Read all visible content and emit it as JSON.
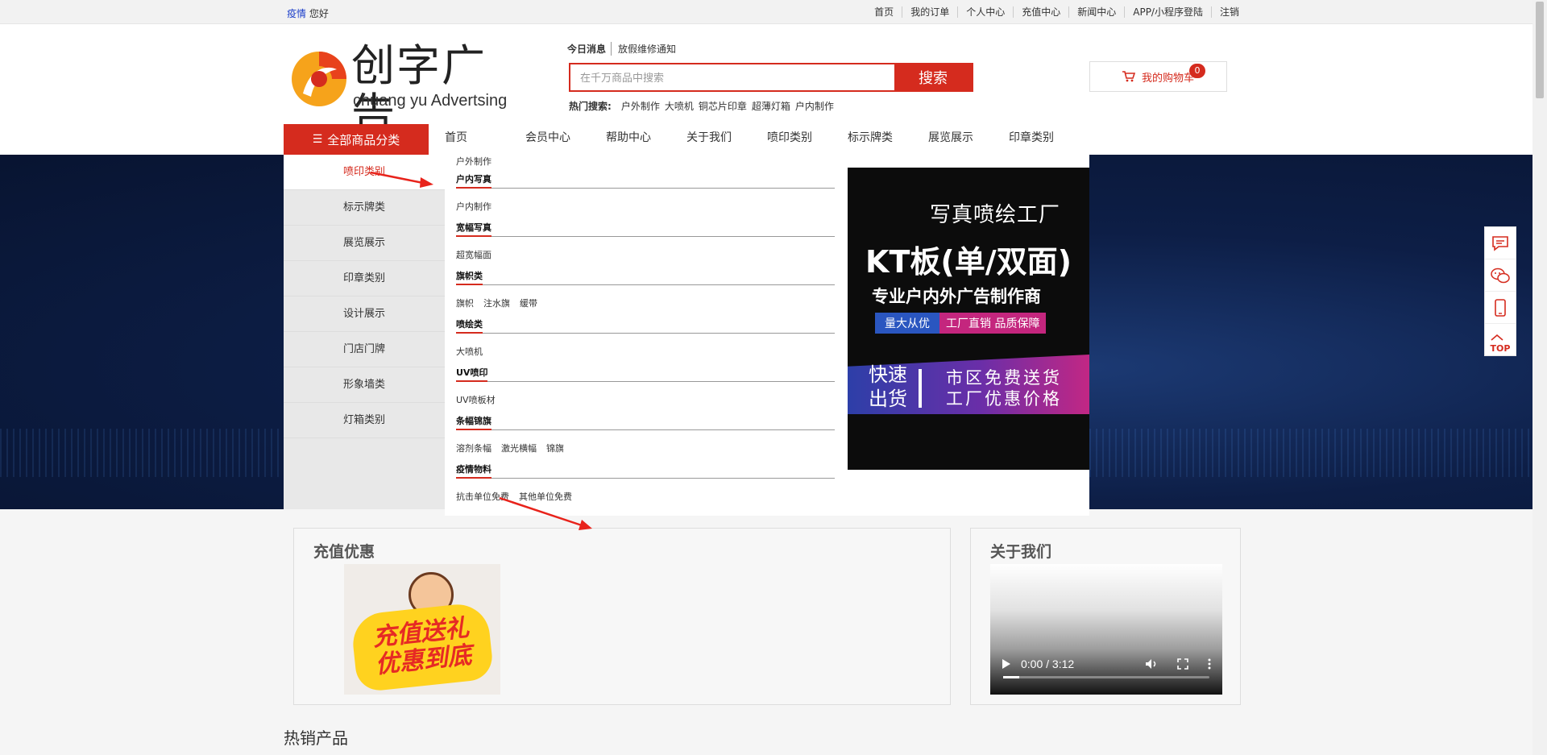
{
  "topbar": {
    "greeting_highlight": "疫情",
    "greeting": "您好",
    "links": [
      "首页",
      "我的订单",
      "个人中心",
      "充值中心",
      "新闻中心",
      "APP/小程序登陆",
      "注销"
    ]
  },
  "logo": {
    "cn": "创字广告",
    "en": "chuang yu Advertsing"
  },
  "notices": {
    "title": "今日消息",
    "item": "放假维修通知"
  },
  "search": {
    "placeholder": "在千万商品中搜索",
    "value": "",
    "button": "搜索"
  },
  "hot": {
    "label": "热门搜索:",
    "items": [
      "户外制作",
      "大喷机",
      "铜芯片印章",
      "超薄灯箱",
      "户内制作"
    ]
  },
  "cart": {
    "label": "我的购物车",
    "count": "0"
  },
  "nav": {
    "all_label": "全部商品分类",
    "items": [
      "首页",
      "会员中心",
      "帮助中心",
      "关于我们",
      "喷印类别",
      "标示牌类",
      "展览展示",
      "印章类别"
    ]
  },
  "category_menu": [
    "喷印类别",
    "标示牌类",
    "展览展示",
    "印章类别",
    "设计展示",
    "门店门牌",
    "形象墙类",
    "灯箱类别"
  ],
  "dropdown": {
    "top_sub": [
      "户外制作"
    ],
    "groups": [
      {
        "title": "户内写真",
        "items": [
          "户内制作"
        ]
      },
      {
        "title": "宽幅写真",
        "items": [
          "超宽幅面"
        ]
      },
      {
        "title": "旗帜类",
        "items": [
          "旗帜",
          "注水旗",
          "缓带"
        ]
      },
      {
        "title": "喷绘类",
        "items": [
          "大喷机"
        ]
      },
      {
        "title": "UV喷印",
        "items": [
          "UV喷板材"
        ]
      },
      {
        "title": "条幅锦旗",
        "items": [
          "溶剂条幅",
          "激光横幅",
          "锦旗"
        ]
      },
      {
        "title": "疫情物料",
        "items": [
          "抗击单位免费",
          "其他单位免费"
        ]
      }
    ]
  },
  "ad": {
    "line1": "写真喷绘工厂",
    "line2": "KT板(单/双面)",
    "line3": "专业户内外广告制作商",
    "tag1": "量大从优",
    "tag2": "工厂直销 品质保障",
    "fast": "快速出货",
    "promo1": "市区免费送货",
    "promo2": "工厂优惠价格"
  },
  "float": {
    "top_label": "TOP"
  },
  "panels": {
    "recharge_title": "充值优惠",
    "recharge_img_line1": "充值送礼",
    "recharge_img_line2": "优惠到底",
    "about_title": "关于我们",
    "video_time": "0:00 / 3:12",
    "video_progress": 0.08
  },
  "section_title": "热销产品",
  "colors": {
    "accent": "#d52b1e",
    "annotation_arrow": "#e8231b",
    "banner": "#0d1e46"
  },
  "icons": {
    "cart": "cart-icon",
    "menu": "list-icon",
    "chat": "chat-icon",
    "wechat": "wechat-icon",
    "mobile": "mobile-icon",
    "top": "top-icon",
    "play": "play-icon",
    "volume": "volume-icon",
    "fullscreen": "fullscreen-icon",
    "more": "more-vertical-icon"
  }
}
